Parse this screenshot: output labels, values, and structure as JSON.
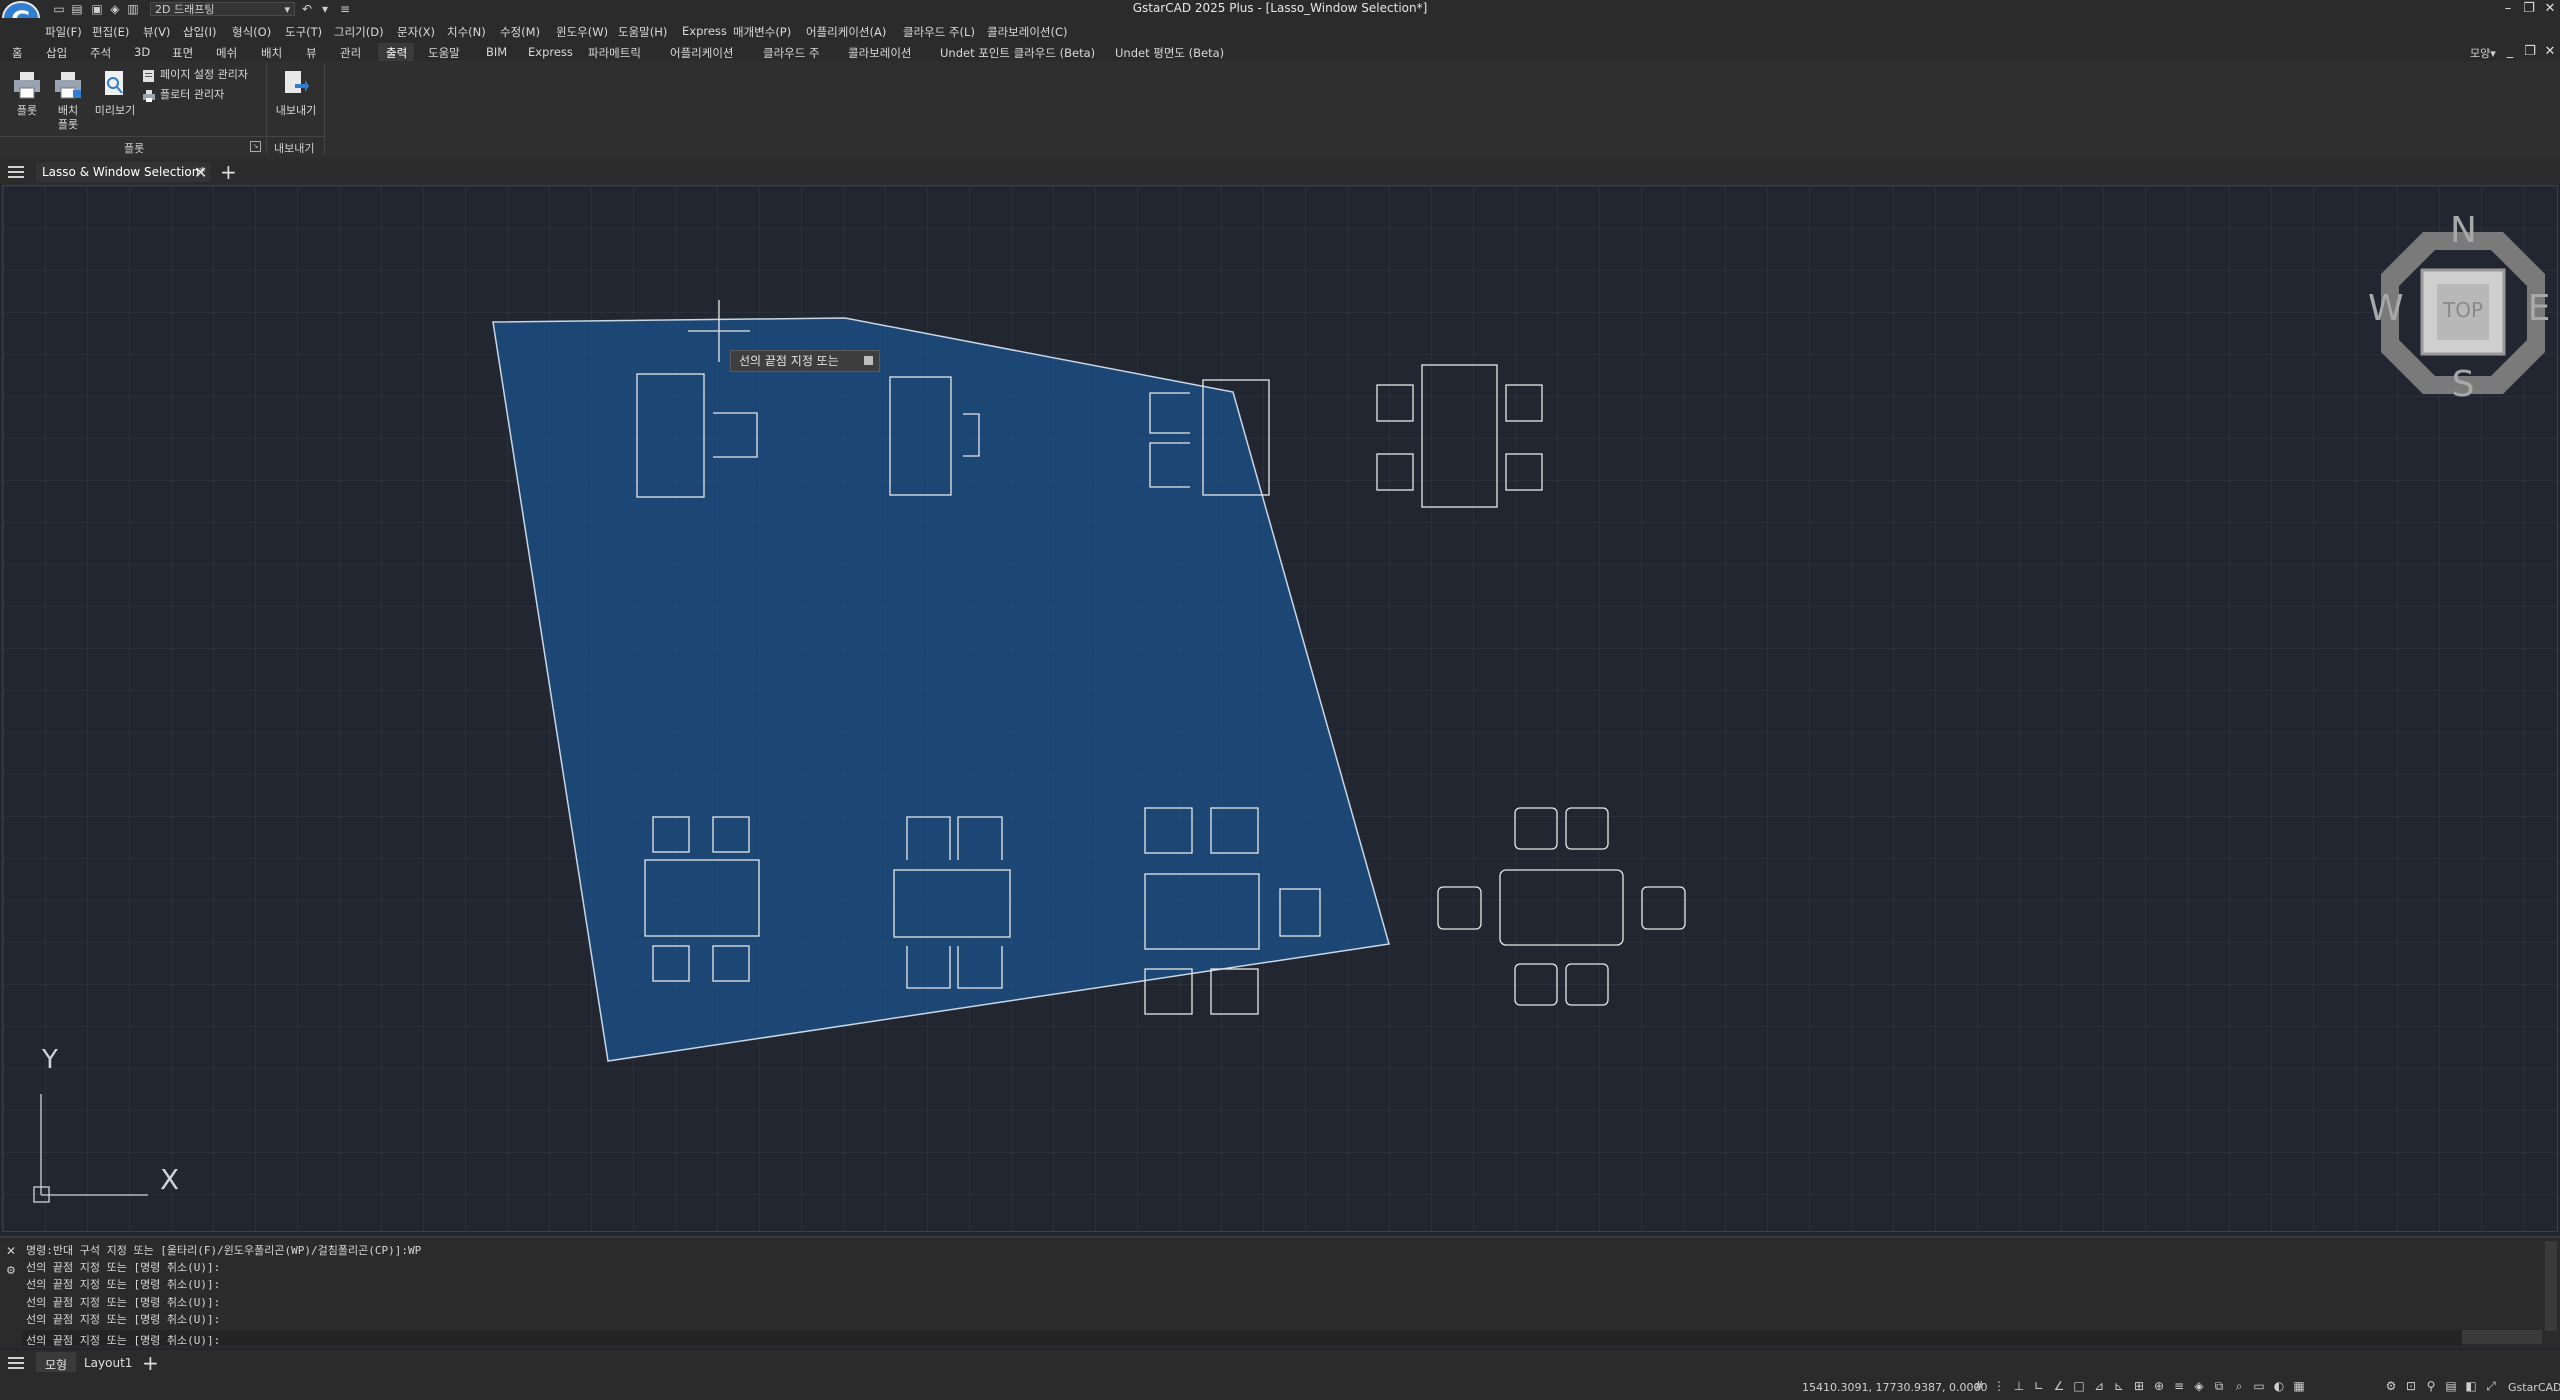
{
  "titlebar": {
    "app_logo": "G",
    "workspace": "2D 드래프팅",
    "title": "GstarCAD 2025 Plus - [Lasso_Window Selection*]"
  },
  "menu": [
    "파일(F)",
    "편집(E)",
    "뷰(V)",
    "삽입(I)",
    "형식(O)",
    "도구(T)",
    "그리기(D)",
    "문자(X)",
    "치수(N)",
    "수정(M)",
    "윈도우(W)",
    "도움말(H)",
    "Express",
    "매개변수(P)",
    "어플리케이션(A)",
    "클라우드 주(L)",
    "콜라보레이션(C)"
  ],
  "ribbon_tabs": [
    "홈",
    "삽입",
    "주석",
    "3D",
    "표면",
    "메쉬",
    "배치",
    "뷰",
    "관리",
    "출력",
    "도움말",
    "BIM",
    "Express",
    "파라메트릭",
    "어플리케이션",
    "클라우드 주",
    "콜라보레이션",
    "Undet 포인트 클라우드 (Beta)",
    "Undet 평면도 (Beta)"
  ],
  "active_tab": "출력",
  "moyang": "모양",
  "ribbon": {
    "plot": "플롯",
    "batch_plot_1": "배치",
    "batch_plot_2": "플롯",
    "preview": "미리보기",
    "page_setup": "페이지 설정 관리자",
    "plotter_manager": "플로터 관리자",
    "export": "내보내기",
    "panel_plot": "플롯",
    "panel_export": "내보내기"
  },
  "document_tab": "Lasso & Window Selection*",
  "canvas": {
    "tooltip": "선의 끝점 지정 또는",
    "viewcube": {
      "top": "TOP",
      "n": "N",
      "s": "S",
      "e": "E",
      "w": "W"
    },
    "ucs": {
      "x": "X",
      "y": "Y"
    }
  },
  "command_lines": [
    "명령:반대 구석 지정 또는 [울타리(F)/윈도우폴리곤(WP)/걸침폴리곤(CP)]:WP",
    "선의 끝점 지정 또는 [명령 취소(U)]:",
    "선의 끝점 지정 또는 [명령 취소(U)]:",
    "선의 끝점 지정 또는 [명령 취소(U)]:",
    "선의 끝점 지정 또는 [명령 취소(U)]:",
    "선의 끝점 지정 또는 [명령 취소(U)]:"
  ],
  "layout_tabs": [
    "모형",
    "Layout1"
  ],
  "status": {
    "coordinates": "15410.3091, 17730.9387, 0.0000",
    "brand": "GstarCAD"
  },
  "colors": {
    "canvas_bg": "#212631",
    "selection_fill": "#1a5a9c",
    "ui_bg": "#2b2b2b",
    "accent": "#2f7fd0"
  }
}
